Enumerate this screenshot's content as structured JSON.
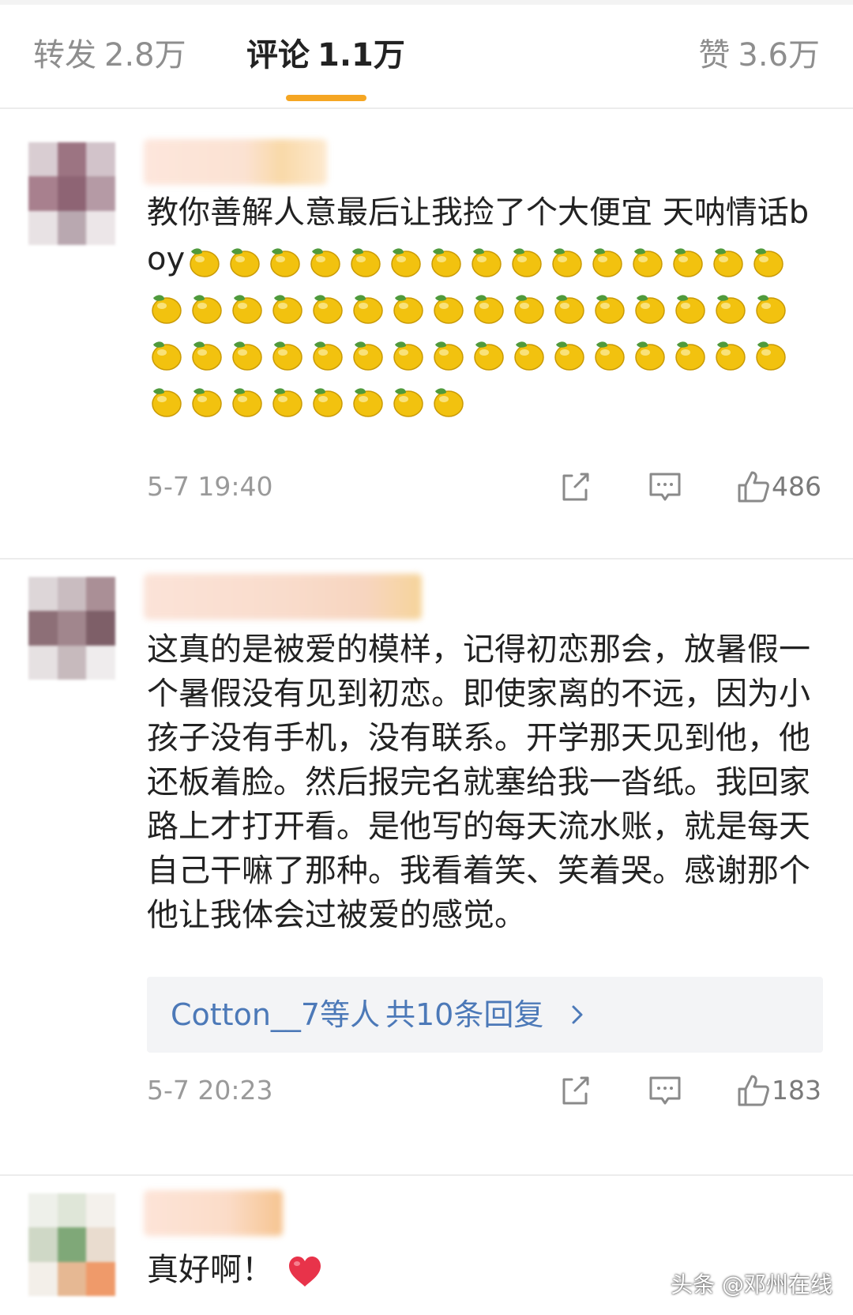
{
  "tabs": {
    "repost": {
      "label": "转发",
      "count": "2.8万"
    },
    "comment": {
      "label": "评论",
      "count": "1.1万"
    },
    "like": {
      "label": "赞",
      "count": "3.6万"
    },
    "active": "comment",
    "accent_color": "#f5a623"
  },
  "comments": [
    {
      "text": "教你善解人意最后让我捡了个大便宜 天呐情话boy",
      "emoji": {
        "icon": "lemon-emoji",
        "count": 55
      },
      "time": "5-7 19:40",
      "likes": "486"
    },
    {
      "text": "这真的是被爱的模样，记得初恋那会，放暑假一个暑假没有见到初恋。即使家离的不远，因为小孩子没有手机，没有联系。开学那天见到他，他还板着脸。然后报完名就塞给我一沓纸。我回家路上才打开看。是他写的每天流水账，就是每天自己干嘛了那种。我看着笑、笑着哭。感谢那个他让我体会过被爱的感觉。",
      "replies": {
        "who": "Cotton__7等人",
        "count_label": "共10条回复"
      },
      "time": "5-7 20:23",
      "likes": "183"
    },
    {
      "text": "真好啊！",
      "emoji": {
        "icon": "red-heart-emoji",
        "count": 1
      }
    }
  ],
  "watermark": "头条 @邓州在线",
  "colors": {
    "link": "#4c79b8",
    "muted": "#9a9a9a",
    "lemon": "#f2c20f",
    "heart": "#e8334a"
  }
}
